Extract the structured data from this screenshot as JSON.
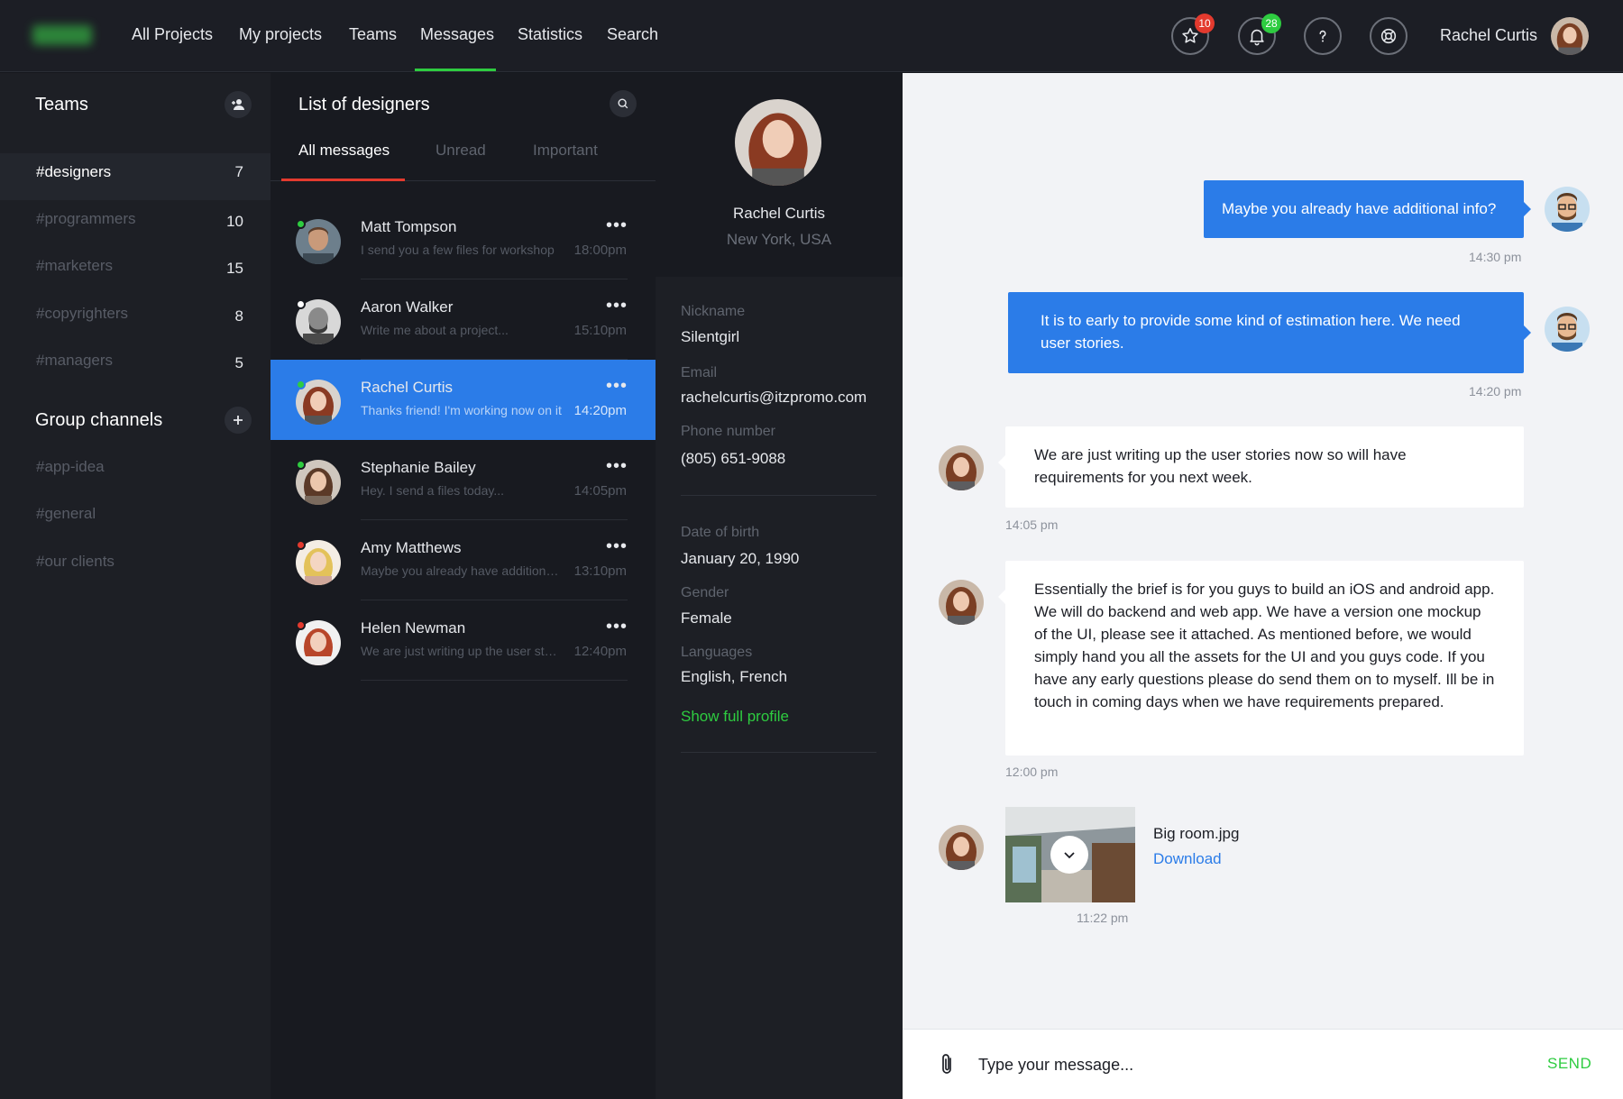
{
  "nav": {
    "items": [
      "All Projects",
      "My projects",
      "Teams",
      "Messages",
      "Statistics",
      "Search"
    ],
    "active": "Messages",
    "accent": "#2ecc40"
  },
  "header": {
    "icons": [
      {
        "name": "star-icon",
        "badge": "10",
        "badge_color": "#e33a2e"
      },
      {
        "name": "bell-icon",
        "badge": "28",
        "badge_color": "#2ecc40"
      },
      {
        "name": "help-icon"
      },
      {
        "name": "lifebuoy-icon"
      }
    ],
    "user_name": "Rachel Curtis"
  },
  "sidebar": {
    "teams_title": "Teams",
    "teams": [
      {
        "label": "#designers",
        "count": "7"
      },
      {
        "label": "#programmers",
        "count": "10"
      },
      {
        "label": "#marketers",
        "count": "15"
      },
      {
        "label": "#copyrighters",
        "count": "8"
      },
      {
        "label": "#managers",
        "count": "5"
      }
    ],
    "channels_title": "Group channels",
    "channels": [
      "#app-idea",
      "#general",
      "#our clients"
    ]
  },
  "list": {
    "title": "List of designers",
    "tabs": [
      "All messages",
      "Unread",
      "Important"
    ],
    "active_tab": "All messages",
    "rows": [
      {
        "name": "Matt Tompson",
        "preview": "I send you a few files for workshop",
        "time": "18:00pm",
        "status": "#2ecc40"
      },
      {
        "name": "Aaron Walker",
        "preview": "Write me about a project...",
        "time": "15:10pm",
        "status": "#ffffff"
      },
      {
        "name": "Rachel Curtis",
        "preview": "Thanks friend! I'm working now on it",
        "time": "14:20pm",
        "status": "#2ecc40"
      },
      {
        "name": "Stephanie Bailey",
        "preview": "Hey. I send a files today...",
        "time": "14:05pm",
        "status": "#2ecc40"
      },
      {
        "name": "Amy Matthews",
        "preview": "Maybe you already have additional info?",
        "time": "13:10pm",
        "status": "#e33a2e"
      },
      {
        "name": "Helen Newman",
        "preview": "We are just writing up the user stories",
        "time": "12:40pm",
        "status": "#e33a2e"
      }
    ],
    "dots": "•••"
  },
  "profile": {
    "name": "Rachel Curtis",
    "location": "New York, USA",
    "fields_a": [
      {
        "label": "Nickname",
        "value": "Silentgirl"
      },
      {
        "label": "Email",
        "value": "rachelcurtis@itzpromo.com"
      },
      {
        "label": "Phone number",
        "value": "(805) 651-9088"
      }
    ],
    "fields_b": [
      {
        "label": "Date of birth",
        "value": "January 20, 1990"
      },
      {
        "label": "Gender",
        "value": "Female"
      },
      {
        "label": "Languages",
        "value": "English, French"
      }
    ],
    "show_full": "Show full profile"
  },
  "chat": {
    "messages": [
      {
        "text": "Maybe you already have additional info?",
        "time": "14:30 pm"
      },
      {
        "text": "It is to early to provide some kind of estimation here. We need user stories.",
        "time": "14:20 pm"
      },
      {
        "text": "We are just writing up the user stories now so will have requirements for you next week.",
        "time": "14:05 pm"
      },
      {
        "text": "Essentially the brief is for you guys to build an iOS and android app. We will do backend and web app. We have a version one mockup of the UI, please see it attached. As mentioned before, we would simply hand you all the assets for the UI and you guys code. If you have any early questions please do send them on to myself. Ill be in touch in coming days when we have requirements prepared.",
        "time": "12:00 pm"
      }
    ],
    "attachment": {
      "file": "Big room.jpg",
      "action": "Download",
      "time": "11:22 pm"
    },
    "composer": {
      "placeholder": "Type your message...",
      "send": "SEND"
    }
  }
}
